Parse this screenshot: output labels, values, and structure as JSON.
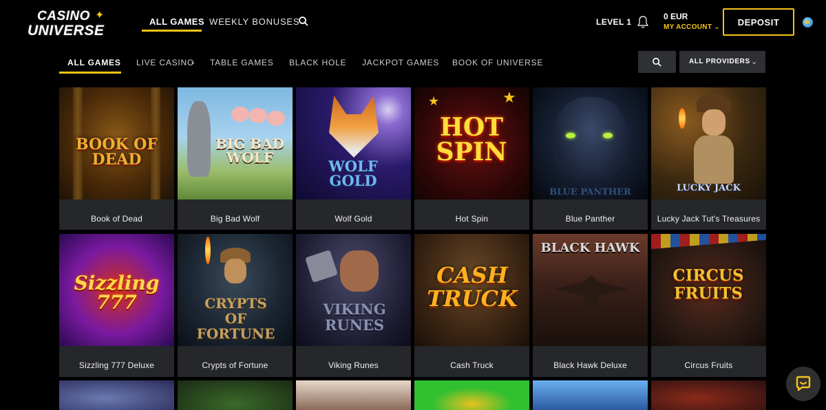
{
  "brand": {
    "line1": "CASINO",
    "line2": "UNIVERSE"
  },
  "header": {
    "nav": [
      {
        "label": "ALL GAMES"
      },
      {
        "label": "WEEKLY BONUSES"
      }
    ],
    "level": "LEVEL 1",
    "balance": "0 EUR",
    "account_label": "MY ACCOUNT ⌄",
    "deposit_label": "DEPOSIT"
  },
  "subnav": {
    "items": [
      {
        "label": "ALL GAMES"
      },
      {
        "label": "LIVE CASINO"
      },
      {
        "label": "TABLE GAMES"
      },
      {
        "label": "BLACK HOLE"
      },
      {
        "label": "JACKPOT GAMES"
      },
      {
        "label": "BOOK OF UNIVERSE"
      }
    ],
    "providers_label": "ALL PROVIDERS"
  },
  "games": [
    {
      "name": "Book of Dead"
    },
    {
      "name": "Big Bad Wolf"
    },
    {
      "name": "Wolf Gold"
    },
    {
      "name": "Hot Spin"
    },
    {
      "name": "Blue Panther"
    },
    {
      "name": "Lucky Jack Tut's Treasures"
    },
    {
      "name": "Sizzling 777 Deluxe"
    },
    {
      "name": "Crypts of Fortune"
    },
    {
      "name": "Viking Runes"
    },
    {
      "name": "Cash Truck"
    },
    {
      "name": "Black Hawk Deluxe"
    },
    {
      "name": "Circus Fruits"
    }
  ],
  "art_titles": {
    "book_of_dead": "BOOK OF DEAD",
    "big_bad_wolf": "BIG BAD WOLF",
    "wolf_gold": "WOLF GOLD",
    "hot_spin": "HOT SPIN",
    "blue_panther": "BLUE PANTHER",
    "lucky_jack": "LUCKY JACK",
    "sizzling": "Sizzling 777",
    "crypts": "CRYPTS OF FORTUNE",
    "viking": "VIKING RUNES",
    "cash_truck": "CASH TRUCK",
    "black_hawk": "BLACK HAWK",
    "circus": "CIRCUS FRUITS"
  },
  "colors": {
    "accent": "#f5c518",
    "tile_bg": "#25272b",
    "control_bg": "#2e3033"
  },
  "icons": {
    "search": "search-icon",
    "bell": "bell-icon",
    "globe": "globe-icon",
    "chat": "chat-icon",
    "chevron": "chevron-down-icon"
  }
}
